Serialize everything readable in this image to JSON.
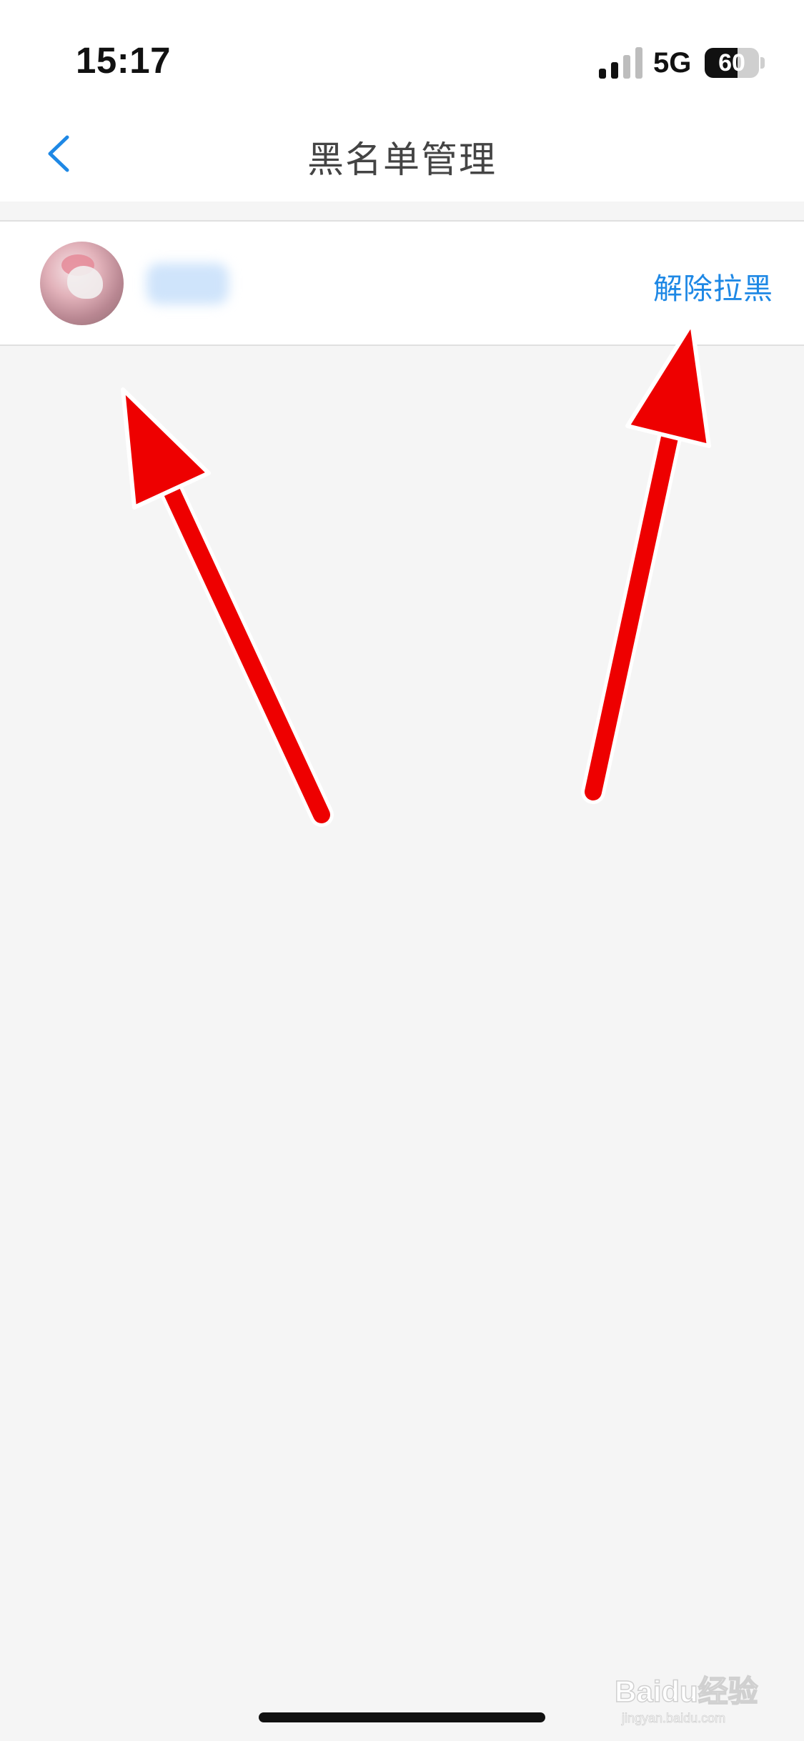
{
  "status_bar": {
    "time": "15:17",
    "network": "5G",
    "battery_level": "60",
    "icons": [
      "signal-icon",
      "battery-icon"
    ]
  },
  "nav": {
    "title": "黑名单管理",
    "back_icon": "chevron-left-icon"
  },
  "blacklist": [
    {
      "username": "",
      "action_label": "解除拉黑"
    }
  ],
  "watermark": {
    "brand": "Baidu经验",
    "domain": "jingyan.baidu.com"
  },
  "colors": {
    "accent": "#1e88e5",
    "page_background": "#f5f5f5",
    "arrow": "#ee0000"
  }
}
